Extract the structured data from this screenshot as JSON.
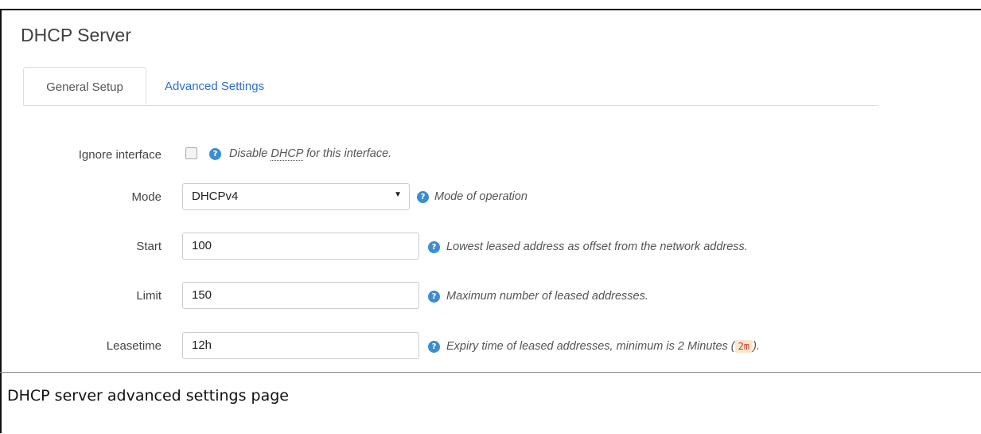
{
  "page": {
    "title": "DHCP Server",
    "caption": "DHCP server advanced settings page"
  },
  "tabs": [
    {
      "label": "General Setup",
      "active": true
    },
    {
      "label": "Advanced Settings",
      "active": false
    }
  ],
  "fields": {
    "ignore_interface": {
      "label": "Ignore interface",
      "checked": false,
      "help_prefix": "Disable ",
      "help_abbr": "DHCP",
      "help_suffix": " for this interface."
    },
    "mode": {
      "label": "Mode",
      "value": "DHCPv4",
      "help": "Mode of operation"
    },
    "start": {
      "label": "Start",
      "value": "100",
      "help": "Lowest leased address as offset from the network address."
    },
    "limit": {
      "label": "Limit",
      "value": "150",
      "help": "Maximum number of leased addresses."
    },
    "leasetime": {
      "label": "Leasetime",
      "value": "12h",
      "help_prefix": "Expiry time of leased addresses, minimum is 2 Minutes (",
      "help_code": "2m",
      "help_suffix": ")."
    }
  },
  "icons": {
    "help": "question-mark-icon",
    "help_glyph": "?",
    "dropdown_glyph": "▼"
  },
  "colors": {
    "link": "#2a6fc9",
    "help_icon": "#3c8dd0",
    "code_bg": "#fbe7cc"
  }
}
